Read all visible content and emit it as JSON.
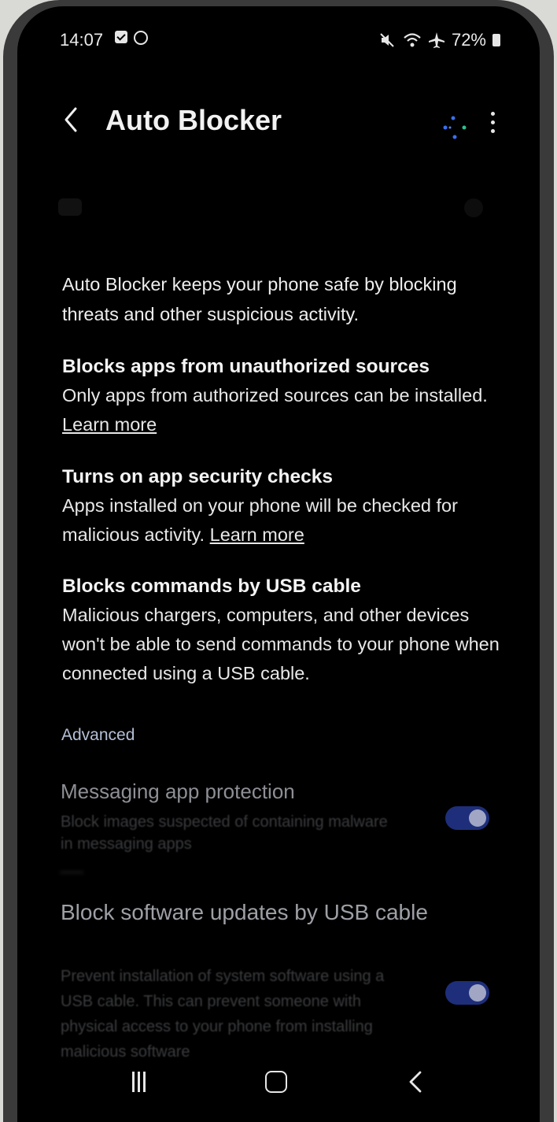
{
  "status_bar": {
    "time": "14:07",
    "battery": "72%",
    "icons": [
      "image-notification-icon",
      "circle-notification-icon",
      "mute-icon",
      "wifi-icon",
      "airplane-icon",
      "battery-icon"
    ]
  },
  "header": {
    "title": "Auto Blocker",
    "back_icon": "chevron-left-icon",
    "menu_icon": "more-vertical-icon"
  },
  "intro": "Auto Blocker keeps your phone safe by blocking threats and other suspicious activity.",
  "sections": [
    {
      "title": "Blocks apps from unauthorized sources",
      "body": "Only apps from authorized sources can be installed.",
      "link": "Learn more"
    },
    {
      "title": "Turns on app security checks",
      "body": "Apps installed on your phone will be checked for malicious activity.",
      "link": "Learn more"
    },
    {
      "title": "Blocks commands by USB cable",
      "body": "Malicious chargers, computers, and other devices won't be able to send commands to your phone when connected using a USB cable."
    }
  ],
  "advanced": {
    "label": "Advanced",
    "items": [
      {
        "title": "Messaging app protection",
        "subtitle": "Block images suspected of containing malware in messaging apps",
        "enabled": true
      },
      {
        "title": "Block software updates by USB cable",
        "subtitle": "Prevent installation of system software using a USB cable. This can prevent someone with physical access to your phone from installing malicious software",
        "enabled": true
      }
    ]
  },
  "nav_bar": {
    "recents_icon": "recents-icon",
    "home_icon": "home-icon",
    "back_icon": "back-icon"
  },
  "colors": {
    "background": "#000000",
    "toggle_track": "#1e2e7a",
    "toggle_knob": "#a0a6c4",
    "section_label": "#b5bfd6"
  }
}
